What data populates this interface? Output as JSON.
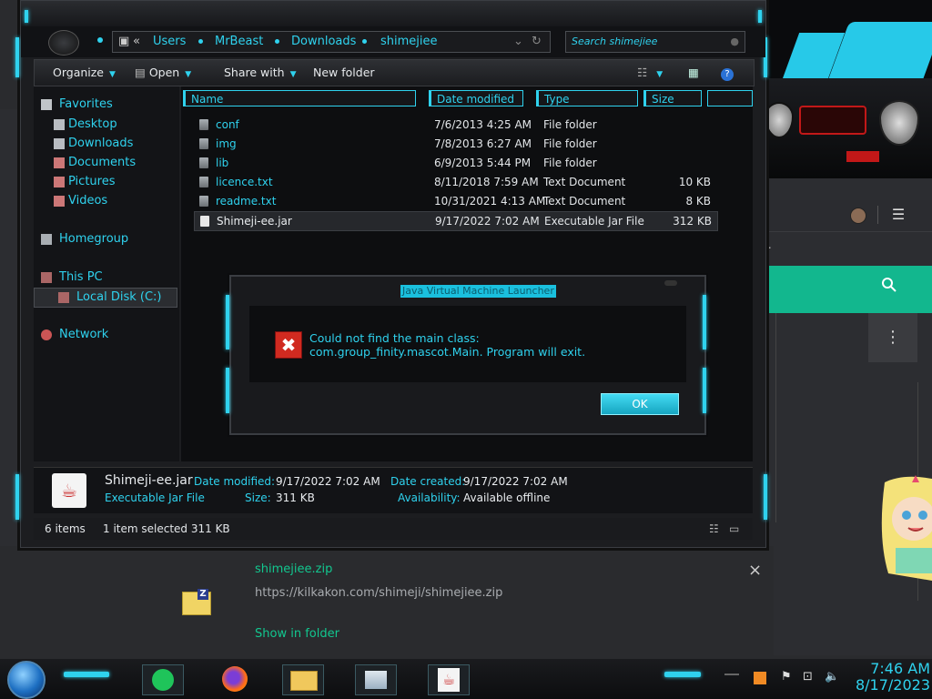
{
  "explorer": {
    "breadcrumb": [
      "«",
      "Users",
      "MrBeast",
      "Downloads",
      "shimejiee"
    ],
    "search_placeholder": "Search shimejiee",
    "toolbar": {
      "organize": "Organize",
      "open": "Open",
      "share_with": "Share with",
      "new_folder": "New folder"
    },
    "nav": [
      {
        "label": "Favorites",
        "icon": "star-icon"
      },
      {
        "label": "Desktop",
        "icon": "desktop-icon"
      },
      {
        "label": "Downloads",
        "icon": "downloads-icon"
      },
      {
        "label": "Documents",
        "icon": "documents-icon"
      },
      {
        "label": "Pictures",
        "icon": "pictures-icon"
      },
      {
        "label": "Videos",
        "icon": "videos-icon"
      },
      {
        "label": "Homegroup",
        "icon": "homegroup-icon"
      },
      {
        "label": "This PC",
        "icon": "computer-icon"
      },
      {
        "label": "Local Disk (C:)",
        "icon": "drive-icon",
        "selected": true
      },
      {
        "label": "Network",
        "icon": "network-icon"
      }
    ],
    "columns": [
      "Name",
      "Date modified",
      "Type",
      "Size"
    ],
    "files": [
      {
        "name": "conf",
        "date": "7/6/2013 4:25 AM",
        "type": "File folder",
        "size": ""
      },
      {
        "name": "img",
        "date": "7/8/2013 6:27 AM",
        "type": "File folder",
        "size": ""
      },
      {
        "name": "lib",
        "date": "6/9/2013 5:44 PM",
        "type": "File folder",
        "size": ""
      },
      {
        "name": "licence.txt",
        "date": "8/11/2018 7:59 AM",
        "type": "Text Document",
        "size": "10 KB"
      },
      {
        "name": "readme.txt",
        "date": "10/31/2021 4:13 AM",
        "type": "Text Document",
        "size": "8 KB"
      },
      {
        "name": "Shimeji-ee.jar",
        "date": "9/17/2022 7:02 AM",
        "type": "Executable Jar File",
        "size": "312 KB",
        "selected": true
      }
    ],
    "details": {
      "file_name": "Shimeji-ee.jar",
      "file_type": "Executable Jar File",
      "date_modified_label": "Date modified:",
      "date_modified": "9/17/2022 7:02 AM",
      "size_label": "Size:",
      "size": "311 KB",
      "date_created_label": "Date created:",
      "date_created": "9/17/2022 7:02 AM",
      "availability_label": "Availability:",
      "availability": "Available offline"
    },
    "status": {
      "items": "6 items",
      "selected": "1 item selected  311 KB"
    }
  },
  "dialog": {
    "title": "Java Virtual Machine Launcher",
    "message": "Could not find the main class: com.group_finity.mascot.Main. Program will exit.",
    "ok": "OK"
  },
  "download": {
    "filename": "shimejiee.zip",
    "url": "https://kilkakon.com/shimeji/shimejiee.zip",
    "show_in_folder": "Show in folder",
    "close": "×"
  },
  "taskbar": {
    "time": "7:46 AM",
    "date": "8/17/2023"
  },
  "colors": {
    "accent": "#2fd2ee",
    "error": "#d02a20",
    "download_green": "#12b78e"
  }
}
